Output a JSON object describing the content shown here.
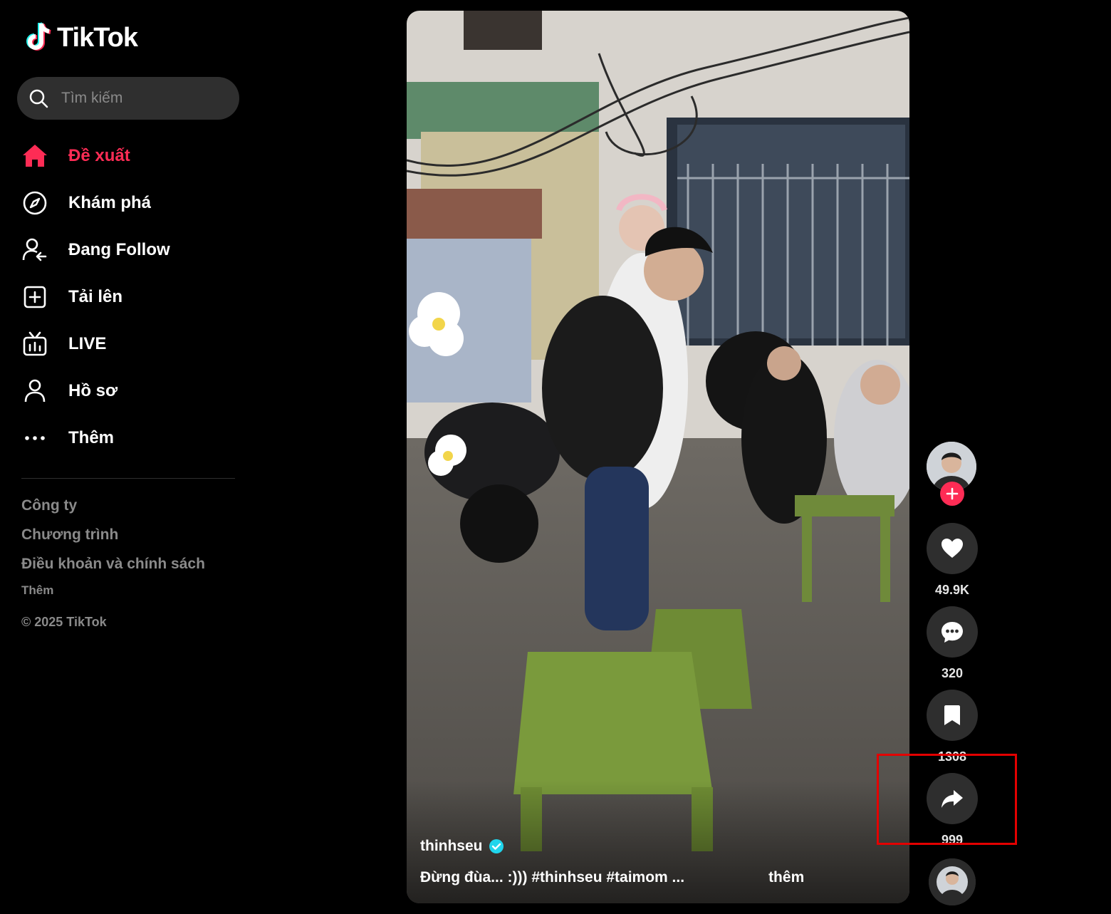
{
  "app": {
    "logo_text": "TikTok"
  },
  "search": {
    "placeholder": "Tìm kiếm"
  },
  "nav": {
    "items": [
      {
        "label": "Đề xuất",
        "icon": "home-icon",
        "active": true
      },
      {
        "label": "Khám phá",
        "icon": "compass-icon"
      },
      {
        "label": "Đang Follow",
        "icon": "following-icon"
      },
      {
        "label": "Tải lên",
        "icon": "upload-icon"
      },
      {
        "label": "LIVE",
        "icon": "live-tv-icon"
      },
      {
        "label": "Hồ sơ",
        "icon": "profile-icon"
      },
      {
        "label": "Thêm",
        "icon": "more-dots-icon"
      }
    ]
  },
  "footer": {
    "links": [
      "Công ty",
      "Chương trình",
      "Điều khoản và chính sách"
    ],
    "more": "Thêm",
    "copyright": "© 2025 TikTok"
  },
  "video": {
    "author": "thinhseu",
    "verified": true,
    "description": "Đừng đùa... :))) #thinhseu  #taimom  ...",
    "more_label": "thêm"
  },
  "actions": {
    "likes": "49.9K",
    "comments": "320",
    "saves": "1308",
    "shares": "999"
  },
  "colors": {
    "accent": "#fe2c55",
    "background": "#000000",
    "button_bg": "#2e2e2e",
    "highlight": "#e30000"
  }
}
